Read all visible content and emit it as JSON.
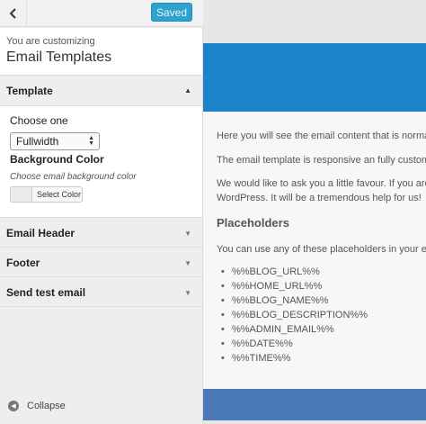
{
  "topbar": {
    "save_label": "Saved",
    "back_icon": "chevron-left-icon"
  },
  "info": {
    "subtitle": "You are customizing",
    "title": "Email Templates"
  },
  "sections": {
    "template": {
      "label": "Template",
      "choose_label": "Choose one",
      "layout_value": "Fullwidth",
      "background_label": "Background Color",
      "background_desc": "Choose email background color",
      "select_color_label": "Select Color"
    },
    "email_header": "Email Header",
    "footer": "Footer",
    "send_test": "Send test email"
  },
  "collapse_label": "Collapse",
  "preview": {
    "intro": "Here you will see the email content that is normal",
    "responsive": "The email template is responsive an fully customiz",
    "favour_line1": "We would like to ask you a little favour. If you are",
    "favour_line2": "WordPress. It will be a tremendous help for us!",
    "placeholders_heading": "Placeholders",
    "placeholders_intro": "You can use any of these placeholders in your em",
    "placeholders": [
      "%%BLOG_URL%%",
      "%%HOME_URL%%",
      "%%BLOG_NAME%%",
      "%%BLOG_DESCRIPTION%%",
      "%%ADMIN_EMAIL%%",
      "%%DATE%%",
      "%%TIME%%"
    ]
  },
  "colors": {
    "save_button": "#2ea2cc",
    "email_header": "#1c82c9",
    "email_footer": "#4b79b8",
    "sidebar_bg": "#eeeeee"
  }
}
